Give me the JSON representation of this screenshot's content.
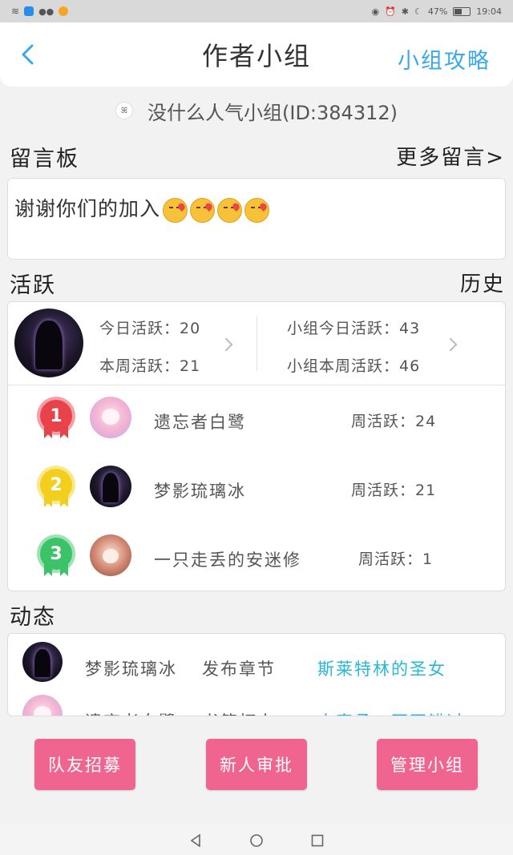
{
  "status": {
    "battery": "47%",
    "time": "19:04",
    "battery_level": 0.47
  },
  "header": {
    "title": "作者小组",
    "guide": "小组攻略",
    "back_icon": "chevron-left-icon"
  },
  "group": {
    "name": "没什么人气小组(ID:384312)"
  },
  "board": {
    "title": "留言板",
    "more": "更多留言>",
    "message": "谢谢你们的加入",
    "emoji_count": 4
  },
  "activity": {
    "title": "活跃",
    "history": "历史",
    "today_label": "今日活跃：20",
    "week_label": "本周活跃：21",
    "group_today_label": "小组今日活跃：43",
    "group_week_label": "小组本周活跃：46",
    "ranking": [
      {
        "rank": "1",
        "name": "遗忘者白鹭",
        "weekly": "周活跃：24",
        "color": "#e8434a"
      },
      {
        "rank": "2",
        "name": "梦影琉璃冰",
        "weekly": "周活跃：21",
        "color": "#f2cf1d"
      },
      {
        "rank": "3",
        "name": "一只走丢的安迷修",
        "weekly": "周活跃：1",
        "color": "#3cc36a"
      }
    ]
  },
  "feed": {
    "title": "动态",
    "items": [
      {
        "name": "梦影琉璃冰",
        "action": "发布章节",
        "target": "斯莱特林的圣女"
      },
      {
        "name": "遗忘者白鹭",
        "action": "书籍打卡",
        "target": "大容承：不再错过"
      }
    ]
  },
  "buttons": {
    "recruit": "队友招募",
    "approve": "新人审批",
    "manage": "管理小组"
  },
  "colors": {
    "accent": "#3aa9e6",
    "button": "#f06590",
    "link": "#27b8d8"
  }
}
